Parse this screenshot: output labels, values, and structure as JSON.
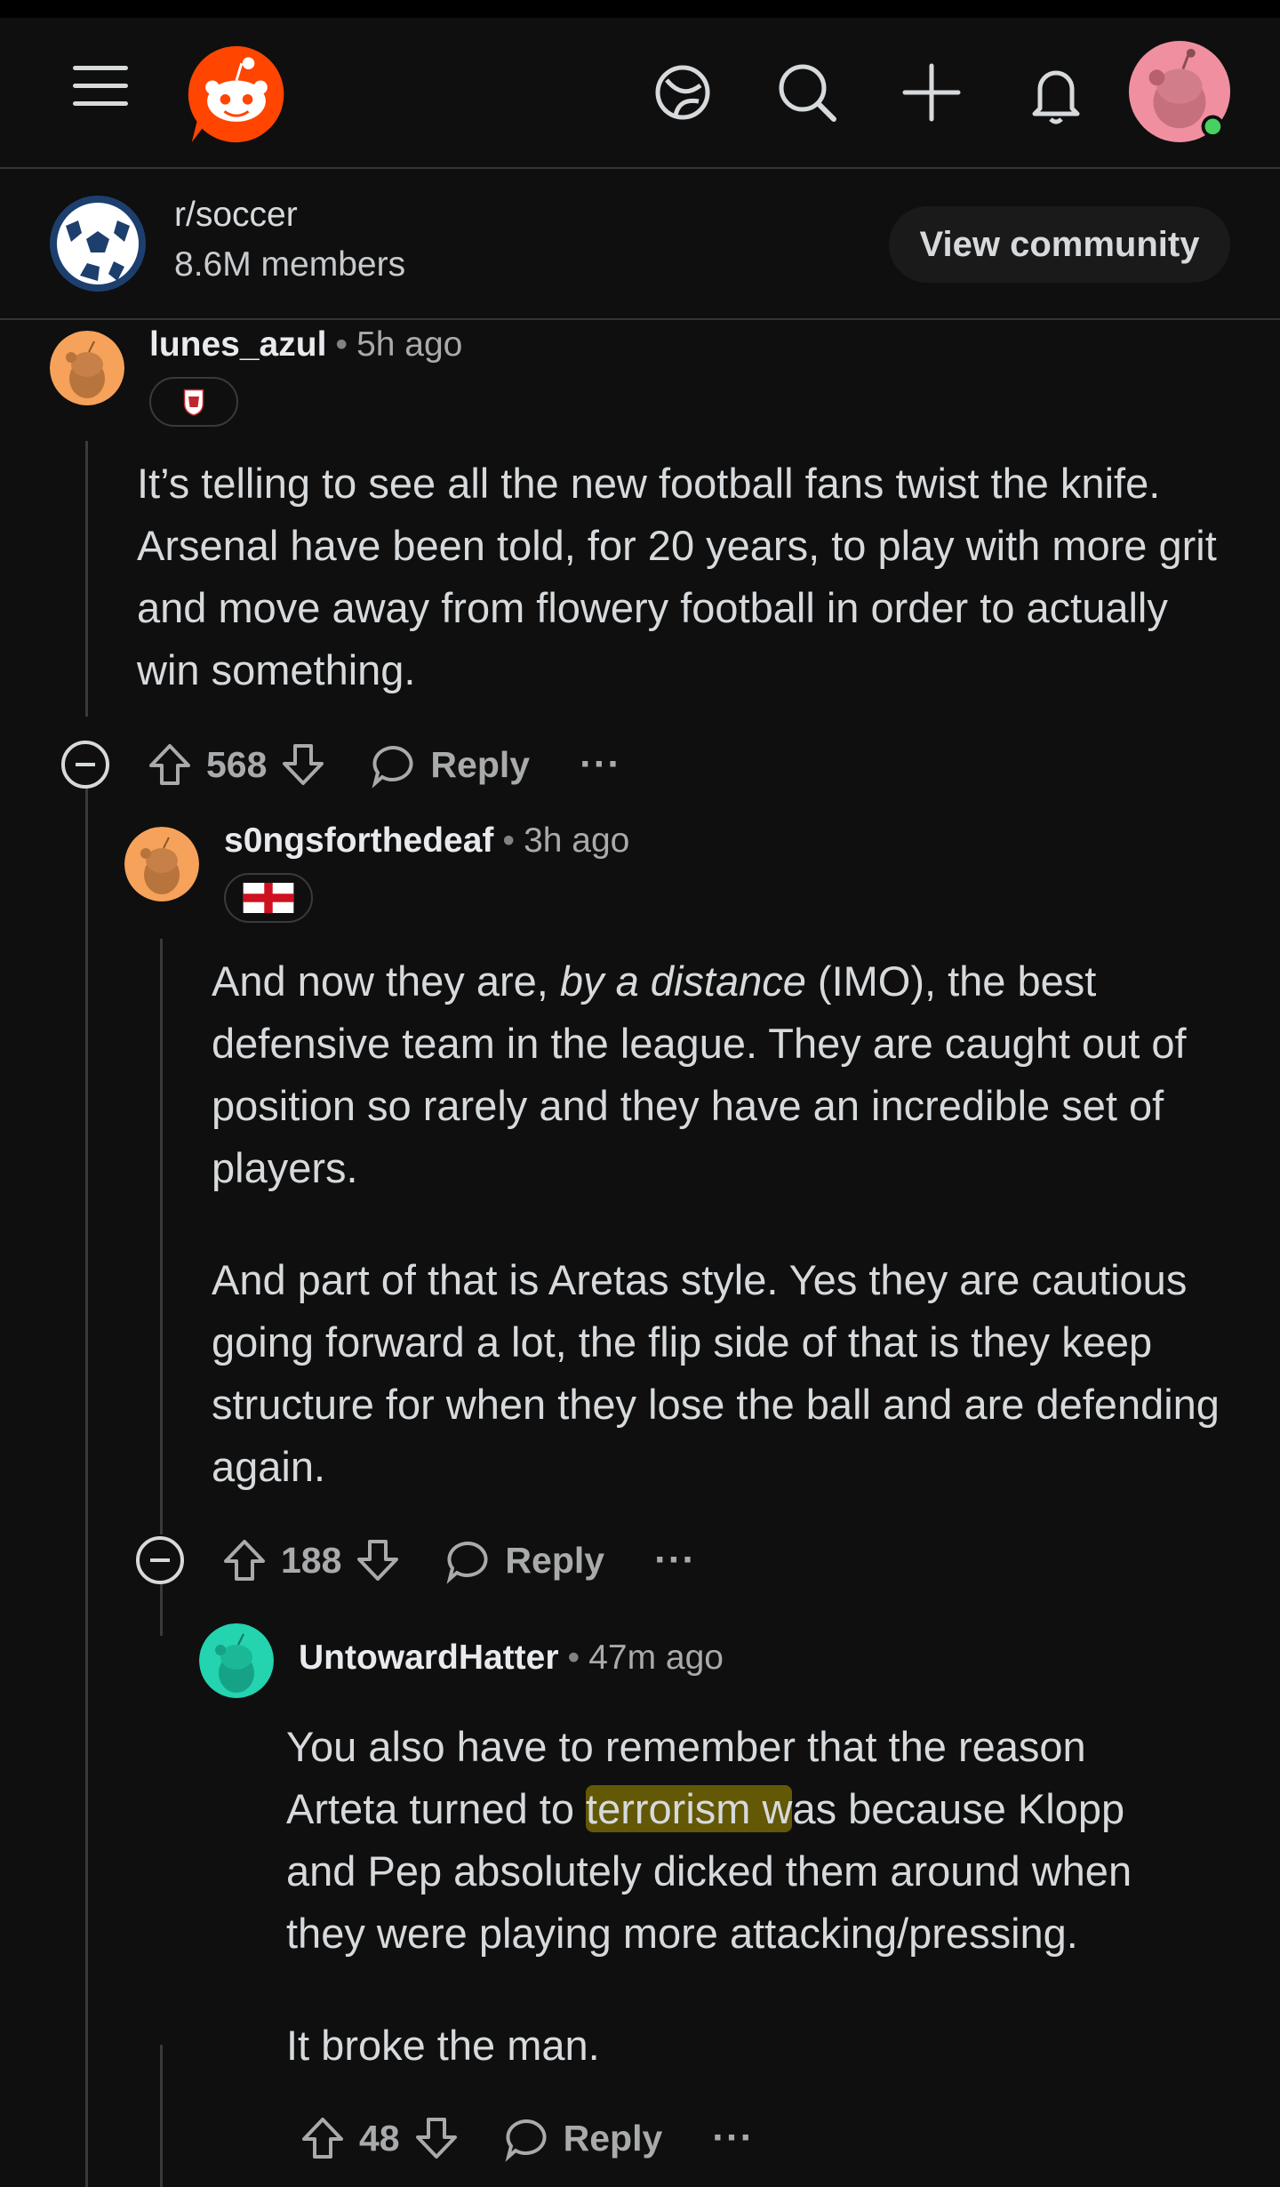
{
  "community": {
    "name": "r/soccer",
    "members": "8.6M members",
    "view_button": "View community"
  },
  "colors": {
    "background": "#0f0f0f",
    "brand": "#ff4500",
    "text": "#d7dadc",
    "muted": "#a8aaab",
    "online": "#46d160"
  },
  "comments": [
    {
      "username": "lunes_azul",
      "time": "5h ago",
      "flair": "middlesbrough-crest",
      "avatar_color": "#f6a25a",
      "body": [
        "It’s telling to see all the new football fans twist the knife. Arsenal have been told, for 20 years, to play with more grit and move away from flowery football in order to actually win something."
      ],
      "votes": "568",
      "reply_label": "Reply",
      "more": "···"
    },
    {
      "username": "s0ngsforthedeaf",
      "time": "3h ago",
      "flair": "england-flag",
      "avatar_color": "#f6a25a",
      "body_line1_pre": "And now they are, ",
      "body_line1_em": "by a distance",
      "body_line1_post": " (IMO), the best defensive team in the league. They are caught out of position so rarely and they have an incredible set of players.",
      "body_p2": "And part of that is Aretas style. Yes they are cautious going forward a lot, the flip side of that is they keep structure for when they lose the ball and are defending again.",
      "votes": "188",
      "reply_label": "Reply",
      "more": "···"
    },
    {
      "username": "UntowardHatter",
      "time": "47m ago",
      "avatar_color": "#24d3b0",
      "body_pre": "You also have to remember that the reason Arteta turned to ",
      "body_highlight": "terrorism w",
      "body_post": "as because Klopp and Pep absolutely dicked them around when they were playing more attacking/pressing.",
      "body_p2": "It broke the man.",
      "votes": "48",
      "reply_label": "Reply",
      "more": "···"
    }
  ]
}
